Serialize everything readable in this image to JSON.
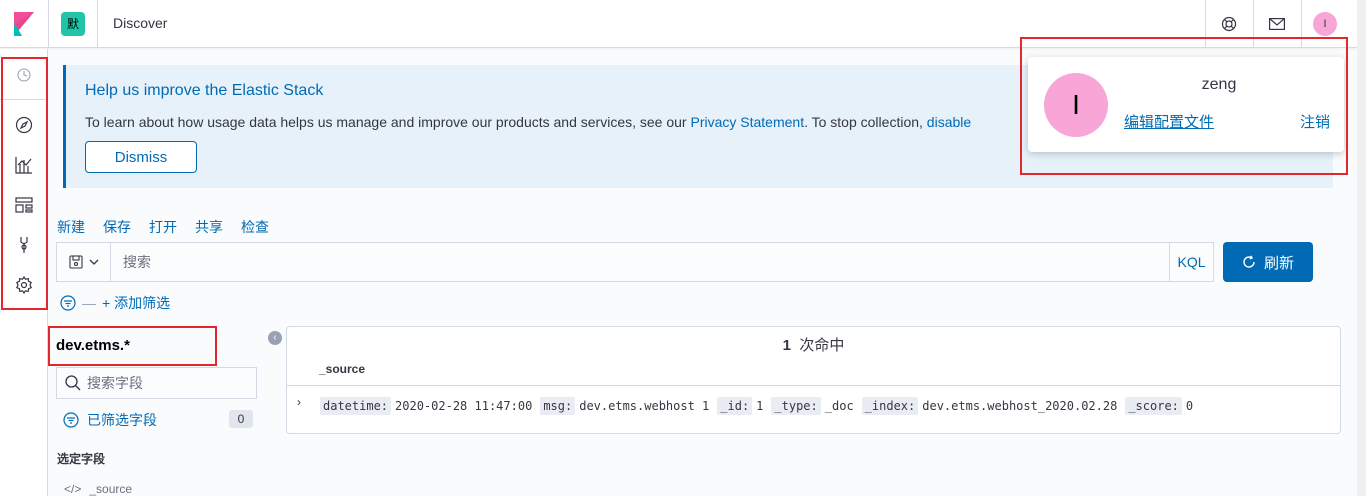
{
  "header": {
    "space_avatar": "默",
    "breadcrumb": "Discover",
    "user_initial": "I"
  },
  "callout": {
    "title": "Help us improve the Elastic Stack",
    "body_prefix": "To learn about how usage data helps us manage and improve our products and services, see our ",
    "privacy_link": "Privacy Statement",
    "body_middle": ". To stop collection, ",
    "disable_link": "disable",
    "dismiss_label": "Dismiss"
  },
  "menu": {
    "new": "新建",
    "save": "保存",
    "open": "打开",
    "share": "共享",
    "inspect": "检查"
  },
  "query": {
    "placeholder": "搜索",
    "language": "KQL",
    "refresh_label": "刷新"
  },
  "filter": {
    "add_label": "+ 添加筛选"
  },
  "sidebar": {
    "index_pattern": "dev.etms.*",
    "field_search_placeholder": "搜索字段",
    "filtered_fields_label": "已筛选字段",
    "filtered_count": "0",
    "selected_fields_title": "选定字段",
    "source_field": "_source"
  },
  "results": {
    "hit_count": "1",
    "hit_suffix": "次命中",
    "column_header": "_source",
    "document": [
      {
        "key": "datetime:",
        "value": "2020-02-28 11:47:00"
      },
      {
        "key": "msg:",
        "value": "dev.etms.webhost 1"
      },
      {
        "key": "_id:",
        "value": "1"
      },
      {
        "key": "_type:",
        "value": "_doc"
      },
      {
        "key": "_index:",
        "value": "dev.etms.webhost_2020.02.28"
      },
      {
        "key": "_score:",
        "value": "0"
      }
    ]
  },
  "user_popover": {
    "avatar_initial": "I",
    "username": "zeng",
    "edit_profile": "编辑配置文件",
    "logout": "注销"
  },
  "colors": {
    "accent": "#006bb4",
    "highlight_border": "#e3272f",
    "avatar_pink": "#f7a6d7",
    "space_green": "#20c5a8"
  }
}
